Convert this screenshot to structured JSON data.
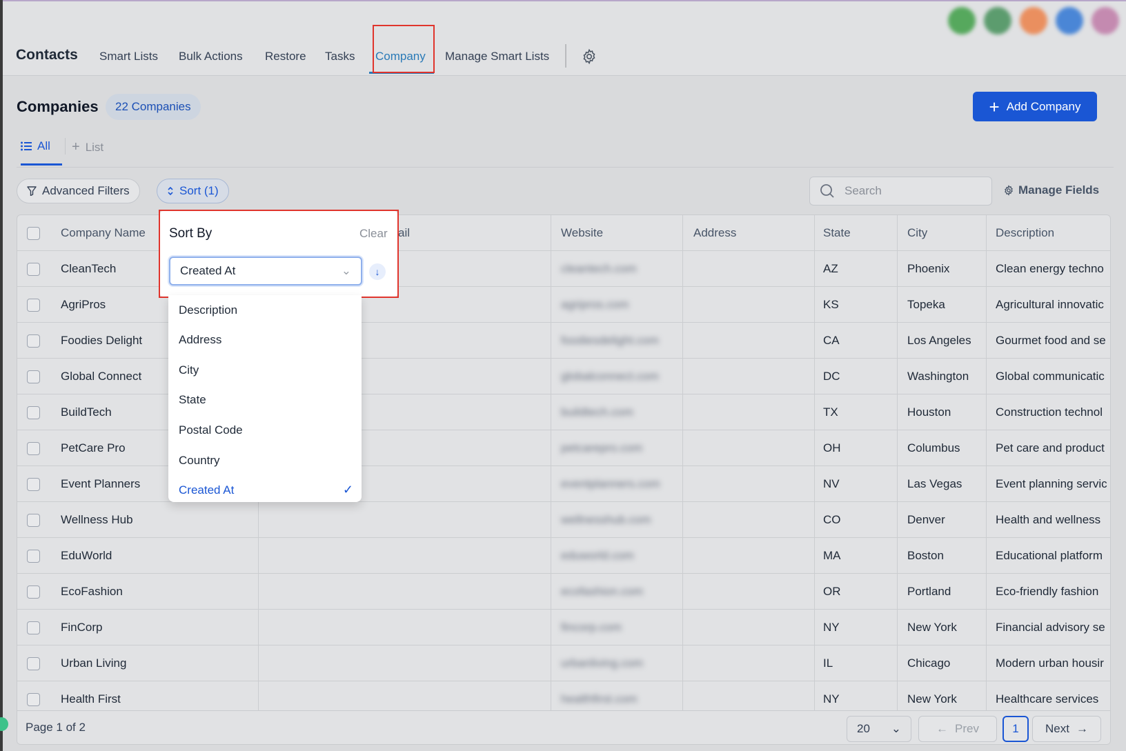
{
  "nav": {
    "title": "Contacts",
    "items": [
      "Smart Lists",
      "Bulk Actions",
      "Restore",
      "Tasks",
      "Company",
      "Manage Smart Lists"
    ],
    "active": "Company"
  },
  "avatars": [
    "#56a85d",
    "#5c9c6e",
    "#ea8f5f",
    "#4a86d6",
    "#c48ab0"
  ],
  "header": {
    "title": "Companies",
    "count_badge": "22 Companies",
    "add_button": "Add Company"
  },
  "tabs": {
    "all": "All",
    "list": "List"
  },
  "toolbar": {
    "advanced_filters": "Advanced Filters",
    "sort": "Sort (1)",
    "search_placeholder": "Search",
    "manage_fields": "Manage Fields"
  },
  "sort_popover": {
    "title": "Sort By",
    "clear": "Clear",
    "selected": "Created At",
    "options": [
      "Description",
      "Address",
      "City",
      "State",
      "Postal Code",
      "Country",
      "Created At"
    ]
  },
  "table": {
    "columns": [
      "Company Name",
      "ail",
      "Website",
      "Address",
      "State",
      "City",
      "Description"
    ],
    "rows": [
      {
        "name": "CleanTech",
        "website": "cleantech.com",
        "state": "AZ",
        "city": "Phoenix",
        "desc": "Clean energy techno"
      },
      {
        "name": "AgriPros",
        "website": "agripros.com",
        "state": "KS",
        "city": "Topeka",
        "desc": "Agricultural innovatic"
      },
      {
        "name": "Foodies Delight",
        "website": "foodiesdelight.com",
        "state": "CA",
        "city": "Los Angeles",
        "desc": "Gourmet food and se"
      },
      {
        "name": "Global Connect",
        "website": "globalconnect.com",
        "state": "DC",
        "city": "Washington",
        "desc": "Global communicatic"
      },
      {
        "name": "BuildTech",
        "website": "buildtech.com",
        "state": "TX",
        "city": "Houston",
        "desc": "Construction technol"
      },
      {
        "name": "PetCare Pro",
        "website": "petcarepro.com",
        "state": "OH",
        "city": "Columbus",
        "desc": "Pet care and product"
      },
      {
        "name": "Event Planners",
        "website": "eventplanners.com",
        "state": "NV",
        "city": "Las Vegas",
        "desc": "Event planning servic"
      },
      {
        "name": "Wellness Hub",
        "website": "wellnesshub.com",
        "state": "CO",
        "city": "Denver",
        "desc": "Health and wellness"
      },
      {
        "name": "EduWorld",
        "website": "eduworld.com",
        "state": "MA",
        "city": "Boston",
        "desc": "Educational platform"
      },
      {
        "name": "EcoFashion",
        "website": "ecofashion.com",
        "state": "OR",
        "city": "Portland",
        "desc": "Eco-friendly fashion"
      },
      {
        "name": "FinCorp",
        "website": "fincorp.com",
        "state": "NY",
        "city": "New York",
        "desc": "Financial advisory se"
      },
      {
        "name": "Urban Living",
        "website": "urbanliving.com",
        "state": "IL",
        "city": "Chicago",
        "desc": "Modern urban housir"
      },
      {
        "name": "Health First",
        "website": "healthfirst.com",
        "state": "NY",
        "city": "New York",
        "desc": "Healthcare services"
      }
    ]
  },
  "pagination": {
    "page_info": "Page 1 of 2",
    "per_page": "20",
    "prev": "Prev",
    "current": "1",
    "next": "Next"
  }
}
